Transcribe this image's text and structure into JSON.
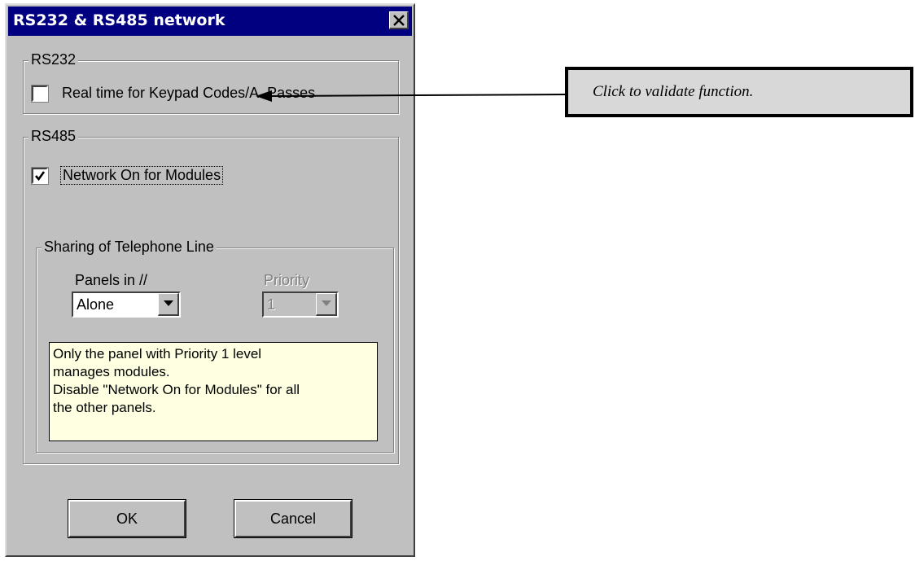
{
  "dialog": {
    "title": "RS232 & RS485 network",
    "rs232": {
      "group_label": "RS232",
      "realtime_label": "Real time for Keypad Codes/A. Passes",
      "realtime_checked": false
    },
    "rs485": {
      "group_label": "RS485",
      "network_label": "Network On for Modules",
      "network_checked": true,
      "sharing": {
        "group_label": "Sharing of Telephone Line",
        "panels_label": "Panels in //",
        "panels_value": "Alone",
        "priority_label": "Priority",
        "priority_value": "1"
      },
      "note_lines": [
        "Only the panel with Priority 1 level",
        "manages modules.",
        "Disable \"Network On for Modules\" for all",
        "the other panels."
      ]
    },
    "buttons": {
      "ok": "OK",
      "cancel": "Cancel"
    }
  },
  "callout": {
    "text": "Click to validate function."
  },
  "colors": {
    "titlebar": "#000080",
    "dialog_face": "#c0c0c0",
    "note_background": "#ffffe1",
    "callout_background": "#d8d8d8"
  }
}
